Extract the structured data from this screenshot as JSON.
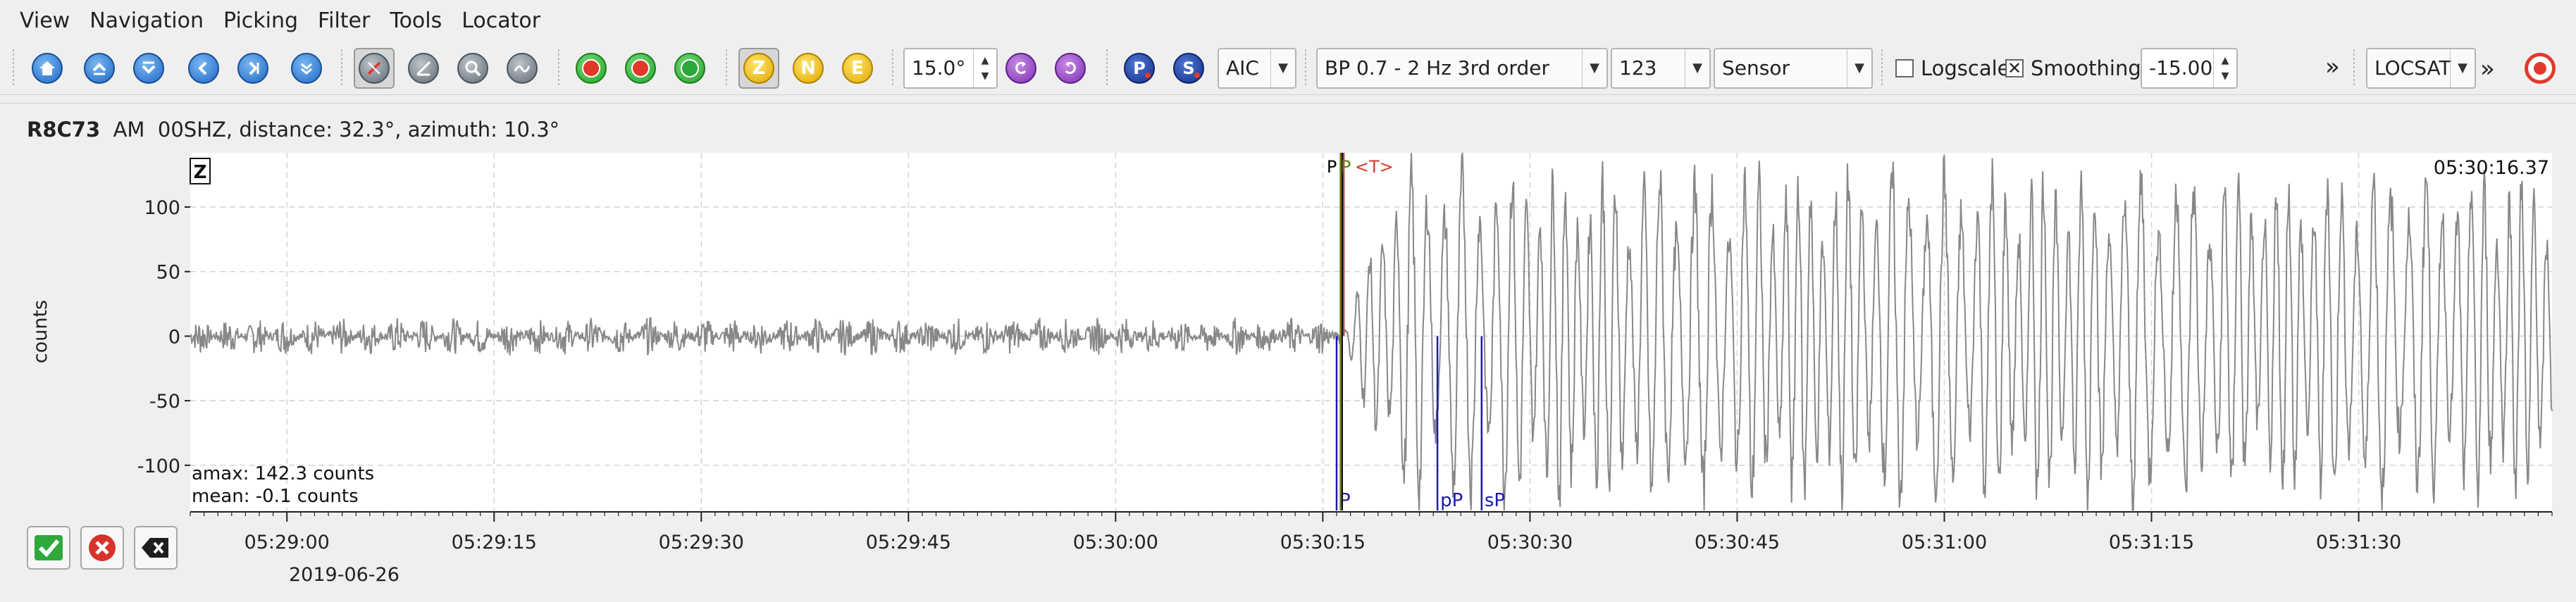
{
  "menu": [
    "View",
    "Navigation",
    "Picking",
    "Filter",
    "Tools",
    "Locator"
  ],
  "toolbar": {
    "angle_value": "15.0°",
    "picker_value": "AIC",
    "filter_value": "BP 0.7 - 2 Hz  3rd order",
    "components_value": "123",
    "unit_value": "Sensor",
    "logscale_label": "Logscale",
    "logscale_checked": false,
    "smoothing_label": "Smoothing",
    "smoothing_checked": true,
    "smoothing_value": "-15.00",
    "overflow_glyph": "»",
    "locator_value": "LOCSAT",
    "channel_buttons": [
      "Z",
      "N",
      "E"
    ],
    "phase_buttons": [
      "P",
      "S"
    ],
    "icons": [
      "home-icon",
      "scroll-up-icon",
      "scroll-down-icon",
      "previous-icon",
      "next-icon",
      "expand-icon",
      "pick-mode-icon",
      "measure-icon",
      "zoom-icon",
      "filter-icon",
      "pick-red-icon",
      "pick-green-icon",
      "locate-icon",
      "relocate-icon",
      "target-icon"
    ]
  },
  "trace": {
    "station": "R8C73",
    "network": "AM",
    "stream": "00SHZ",
    "details": "distance: 32.3°, azimuth: 10.3°",
    "component": "Z",
    "ylabel": "counts",
    "time_readout": "05:30:16.37",
    "amax": "amax: 142.3 counts",
    "mean": "mean: -0.1 counts",
    "date": "2019-06-26",
    "top_picks": [
      {
        "label": "P",
        "color": "#000000"
      },
      {
        "label": "P",
        "color": "#6a7a1a"
      },
      {
        "label": "<T>",
        "color": "#d23a2a"
      }
    ],
    "theoretical_picks": [
      "P",
      "pP",
      "sP"
    ]
  },
  "chart_data": {
    "type": "line",
    "title": "",
    "xlabel": "",
    "ylabel": "counts",
    "xticks": [
      "05:29:00",
      "05:29:15",
      "05:29:30",
      "05:29:45",
      "05:30:00",
      "05:30:15",
      "05:30:30",
      "05:30:45",
      "05:31:00",
      "05:31:15",
      "05:31:30"
    ],
    "yticks": [
      100,
      50,
      0,
      -50,
      -100
    ],
    "xlim": [
      "05:28:53",
      "05:31:44"
    ],
    "ylim": [
      -135,
      142
    ],
    "grid": true,
    "series": [
      {
        "color": "#888888",
        "noise_amplitude": 15,
        "signal_amplitude": 142.3,
        "onset": "05:30:16.37"
      }
    ],
    "picks": [
      {
        "label": "P",
        "time": "05:30:16.4",
        "kind": "manual"
      },
      {
        "label": "P",
        "time": "05:30:16.0",
        "kind": "theoretical"
      },
      {
        "label": "pP",
        "time": "05:30:23.3",
        "kind": "theoretical"
      },
      {
        "label": "sP",
        "time": "05:30:26.5",
        "kind": "theoretical"
      }
    ]
  },
  "actions": [
    "accept-button",
    "reject-button",
    "clear-button"
  ]
}
